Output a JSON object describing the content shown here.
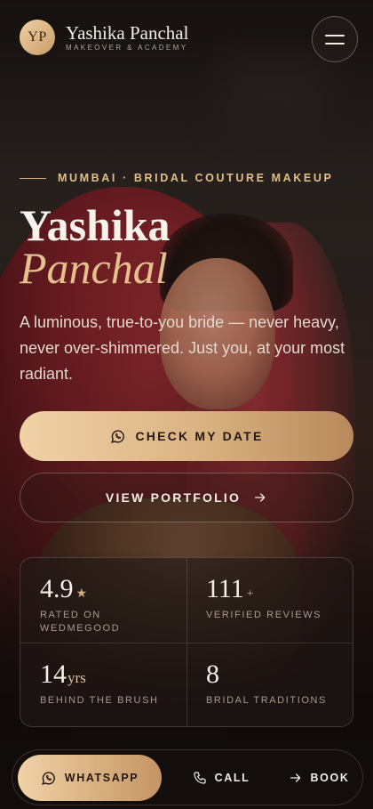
{
  "header": {
    "logo_initials": "YP",
    "brand_name": "Yashika Panchal",
    "brand_tagline": "MAKEOVER & ACADEMY",
    "menu_icon": "hamburger-icon"
  },
  "hero": {
    "eyebrow": "MUMBAI · BRIDAL COUTURE MAKEUP",
    "title_line1": "Yashika",
    "title_line2": "Panchal",
    "lead": "A luminous, true-to-you bride — never heavy, never over-shimmered. Just you, at your most radiant.",
    "primary_cta": "CHECK MY DATE",
    "primary_cta_icon": "whatsapp-icon",
    "secondary_cta": "VIEW PORTFOLIO",
    "secondary_cta_icon": "arrow-right-icon"
  },
  "stats": [
    {
      "value": "4.9",
      "suffix": "★",
      "label": "RATED ON WEDMEGOOD"
    },
    {
      "value": "111",
      "suffix": "+",
      "label": "VERIFIED REVIEWS"
    },
    {
      "value": "14",
      "suffix": "yrs",
      "label": "BEHIND THE BRUSH"
    },
    {
      "value": "8",
      "suffix": "",
      "label": "BRIDAL TRADITIONS"
    }
  ],
  "dock": {
    "whatsapp": "WHATSAPP",
    "call": "CALL",
    "book": "BOOK"
  },
  "colors": {
    "accent_gold": "#d9b282",
    "background": "#120d0b",
    "text": "#f4ece3"
  }
}
